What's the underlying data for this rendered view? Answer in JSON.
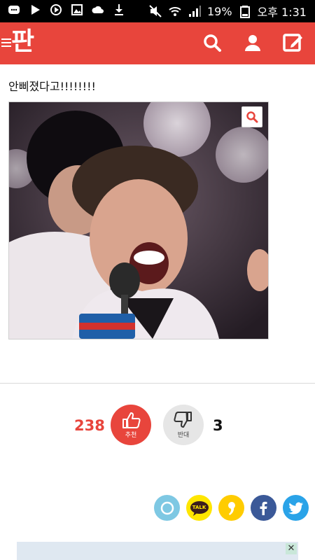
{
  "status_bar": {
    "battery": "19%",
    "time": "오후 1:31"
  },
  "app": {
    "logo": "판",
    "accent_color": "#e8453c"
  },
  "toolbar": {
    "icons": [
      "search-icon",
      "user-icon",
      "edit-icon"
    ]
  },
  "post": {
    "title": "안삐졌다고!!!!!!!!"
  },
  "votes": {
    "up_count": "238",
    "up_label": "추천",
    "down_label": "반대",
    "down_count": "3"
  },
  "share": {
    "buttons": [
      "comment-icon",
      "kakaotalk-icon",
      "kakaostory-icon",
      "facebook-icon",
      "twitter-icon"
    ],
    "talk_label": "TALK"
  },
  "ad": {
    "close_label": "✕"
  }
}
